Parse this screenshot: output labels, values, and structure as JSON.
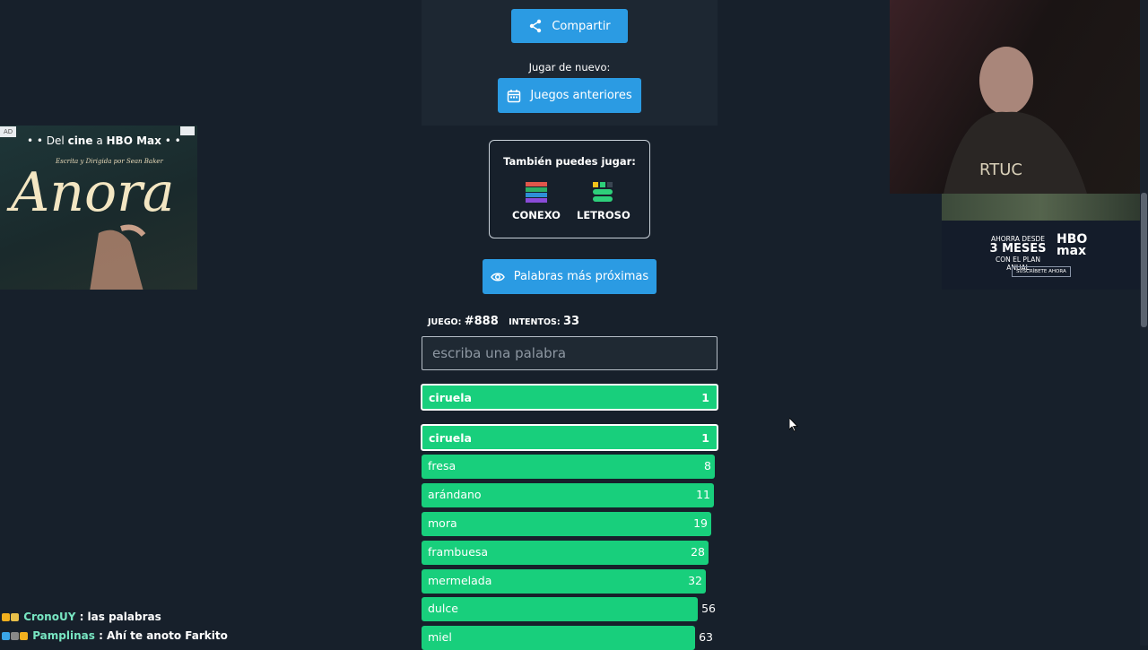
{
  "top": {
    "share_label": "Compartir",
    "play_again_label": "Jugar de nuevo:",
    "previous_games_label": "Juegos anteriores"
  },
  "also_play": {
    "title": "También puedes jugar:",
    "games": [
      "CONEXO",
      "LETROSO"
    ]
  },
  "closest_words_label": "Palabras más próximas",
  "meta": {
    "game_label": "JUEGO:",
    "game_number": "#888",
    "attempts_label": "INTENTOS:",
    "attempts": "33"
  },
  "input": {
    "placeholder": "escriba una palabra",
    "value": ""
  },
  "last_guess": {
    "word": "ciruela",
    "rank": "1"
  },
  "guesses": [
    {
      "word": "ciruela",
      "rank": "1"
    },
    {
      "word": "fresa",
      "rank": "8"
    },
    {
      "word": "arándano",
      "rank": "11"
    },
    {
      "word": "mora",
      "rank": "19"
    },
    {
      "word": "frambuesa",
      "rank": "28"
    },
    {
      "word": "mermelada",
      "rank": "32"
    },
    {
      "word": "dulce",
      "rank": "56"
    },
    {
      "word": "miel",
      "rank": "63"
    }
  ],
  "ad_left": {
    "badge": "AD",
    "tagline_pre": "• • Del",
    "tagline_mid": "cine",
    "tagline_a": "a",
    "tagline_brand": "HBO Max",
    "tagline_post": "• •",
    "subtitle": "Escrita y Dirigida por Sean Baker",
    "title": "Anora"
  },
  "ad_right": {
    "line1": "AHORRA DESDE",
    "line2": "3 MESES",
    "line3": "CON EL PLAN ANUAL",
    "logo_top": "HBO",
    "logo_bottom": "max",
    "cta": "SUSCRÍBETE AHORA"
  },
  "chat": [
    {
      "user": "CronoUY",
      "message": ": las palabras"
    },
    {
      "user": "Pamplinas",
      "message": ": Ahí te anoto Farkito"
    }
  ],
  "colors": {
    "background": "#17202b",
    "accent_blue": "#2b9be3",
    "guess_green": "#18cf7c"
  }
}
